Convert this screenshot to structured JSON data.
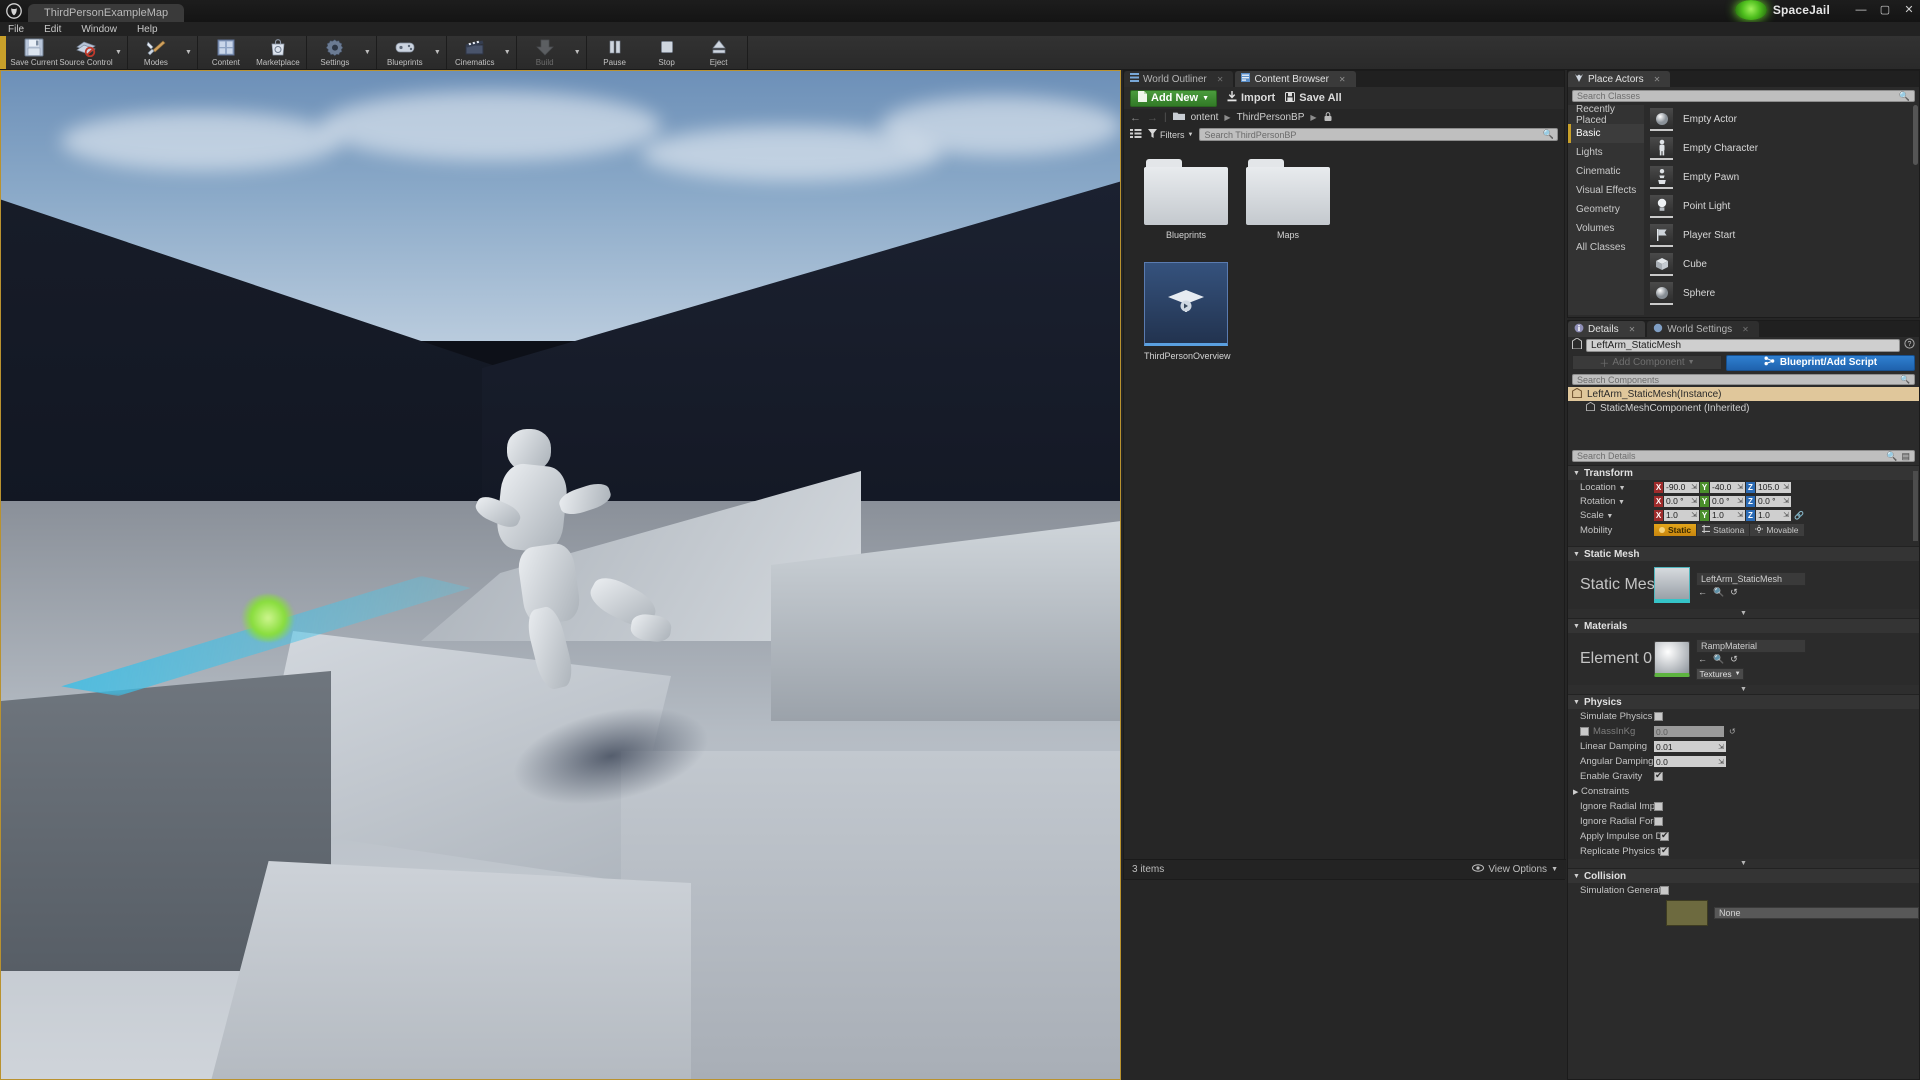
{
  "titlebar": {
    "tab_label": "ThirdPersonExampleMap",
    "brand": "SpaceJail",
    "minimize": "—",
    "maximize": "▢",
    "close": "✕"
  },
  "menubar": {
    "items": [
      "File",
      "Edit",
      "Window",
      "Help"
    ]
  },
  "toolbar": {
    "buttons": [
      {
        "label": "Save Current",
        "icon": "save-icon",
        "caret": false,
        "dim": false
      },
      {
        "label": "Source Control",
        "icon": "source-control-icon",
        "caret": true,
        "dim": false
      },
      {
        "label": "Modes",
        "icon": "modes-icon",
        "caret": true,
        "dim": false
      },
      {
        "label": "Content",
        "icon": "content-icon",
        "caret": false,
        "dim": false
      },
      {
        "label": "Marketplace",
        "icon": "marketplace-icon",
        "caret": false,
        "dim": false
      },
      {
        "label": "Settings",
        "icon": "settings-icon",
        "caret": true,
        "dim": false
      },
      {
        "label": "Blueprints",
        "icon": "blueprints-icon",
        "caret": true,
        "dim": false
      },
      {
        "label": "Cinematics",
        "icon": "cinematics-icon",
        "caret": true,
        "dim": false
      },
      {
        "label": "Build",
        "icon": "build-icon",
        "caret": true,
        "dim": true
      },
      {
        "label": "Pause",
        "icon": "pause-icon",
        "caret": false,
        "dim": false
      },
      {
        "label": "Stop",
        "icon": "stop-icon",
        "caret": false,
        "dim": false
      },
      {
        "label": "Eject",
        "icon": "eject-icon",
        "caret": false,
        "dim": false
      }
    ]
  },
  "content_browser": {
    "tabs": [
      {
        "label": "World Outliner",
        "active": false,
        "icon": "outliner-icon"
      },
      {
        "label": "Content Browser",
        "active": true,
        "icon": "content-browser-icon"
      }
    ],
    "add_new": "Add New",
    "import": "Import",
    "save_all": "Save All",
    "breadcrumb": [
      "ontent",
      "ThirdPersonBP"
    ],
    "filters_label": "Filters",
    "search_placeholder": "Search ThirdPersonBP",
    "assets": [
      {
        "name": "Blueprints",
        "type": "folder"
      },
      {
        "name": "Maps",
        "type": "folder"
      },
      {
        "name": "ThirdPersonOverview",
        "type": "blueprint"
      }
    ],
    "status_count": "3 items",
    "view_options": "View Options"
  },
  "place_actors": {
    "tab_label": "Place Actors",
    "search_placeholder": "Search Classes",
    "categories": [
      {
        "label": "Recently Placed",
        "active": false
      },
      {
        "label": "Basic",
        "active": true
      },
      {
        "label": "Lights",
        "active": false
      },
      {
        "label": "Cinematic",
        "active": false
      },
      {
        "label": "Visual Effects",
        "active": false
      },
      {
        "label": "Geometry",
        "active": false
      },
      {
        "label": "Volumes",
        "active": false
      },
      {
        "label": "All Classes",
        "active": false
      }
    ],
    "items": [
      {
        "label": "Empty Actor",
        "icon": "sphere-actor-icon"
      },
      {
        "label": "Empty Character",
        "icon": "character-icon"
      },
      {
        "label": "Empty Pawn",
        "icon": "pawn-icon"
      },
      {
        "label": "Point Light",
        "icon": "point-light-icon"
      },
      {
        "label": "Player Start",
        "icon": "player-start-icon"
      },
      {
        "label": "Cube",
        "icon": "cube-icon"
      },
      {
        "label": "Sphere",
        "icon": "sphere-icon"
      }
    ]
  },
  "details": {
    "tabs": [
      {
        "label": "Details",
        "active": true,
        "icon": "details-icon"
      },
      {
        "label": "World Settings",
        "active": false,
        "icon": "world-settings-icon"
      }
    ],
    "actor_name": "LeftArm_StaticMesh",
    "add_component": "Add Component",
    "blueprint_button": "Blueprint/Add Script",
    "component_search_placeholder": "Search Components",
    "components": [
      {
        "label": "LeftArm_StaticMesh(Instance)",
        "selected": true
      },
      {
        "label": "StaticMeshComponent (Inherited)",
        "selected": false
      }
    ],
    "details_search_placeholder": "Search Details",
    "sections": {
      "transform": {
        "title": "Transform",
        "location": {
          "label": "Location",
          "x": "-90.0",
          "y": "-40.0",
          "z": "105.0"
        },
        "rotation": {
          "label": "Rotation",
          "x": "0.0 °",
          "y": "0.0 °",
          "z": "0.0 °"
        },
        "scale": {
          "label": "Scale",
          "x": "1.0",
          "y": "1.0",
          "z": "1.0"
        },
        "mobility": {
          "label": "Mobility",
          "options": [
            "Static",
            "Stationa",
            "Movable"
          ],
          "selected": "Static"
        }
      },
      "static_mesh": {
        "title": "Static Mesh",
        "row_label": "Static Mesh",
        "value": "LeftArm_StaticMesh"
      },
      "materials": {
        "title": "Materials",
        "row_label": "Element 0",
        "value": "RampMaterial",
        "textures_button": "Textures"
      },
      "physics": {
        "title": "Physics",
        "rows": [
          {
            "label": "Simulate Physics",
            "type": "checkbox",
            "value": false
          },
          {
            "label": "MassInKg",
            "type": "checkbox_field",
            "value": false,
            "field": "0.0"
          },
          {
            "label": "Linear Damping",
            "type": "field",
            "field": "0.01"
          },
          {
            "label": "Angular Damping",
            "type": "field",
            "field": "0.0"
          },
          {
            "label": "Enable Gravity",
            "type": "checkbox",
            "value": true
          },
          {
            "label": "Constraints",
            "type": "group"
          },
          {
            "label": "Ignore Radial Impulse",
            "type": "checkbox",
            "value": false
          },
          {
            "label": "Ignore Radial Force",
            "type": "checkbox",
            "value": false
          },
          {
            "label": "Apply Impulse on Dama",
            "type": "checkbox",
            "value": true
          },
          {
            "label": "Replicate Physics to Au",
            "type": "checkbox",
            "value": true
          }
        ]
      },
      "collision": {
        "title": "Collision",
        "rows": [
          {
            "label": "Simulation Generates H",
            "type": "checkbox",
            "value": false
          }
        ],
        "preset_value": "None"
      }
    }
  },
  "colors": {
    "accent_green": "#3f8c32",
    "accent_blue": "#2f7fd0",
    "viewport_border": "#b9922f",
    "axis_x": "#9e2b2b",
    "axis_y": "#4a8f2b",
    "axis_z": "#2b6bb5",
    "mobility_static": "#e3a51b",
    "selection_row": "#e0c79b"
  }
}
